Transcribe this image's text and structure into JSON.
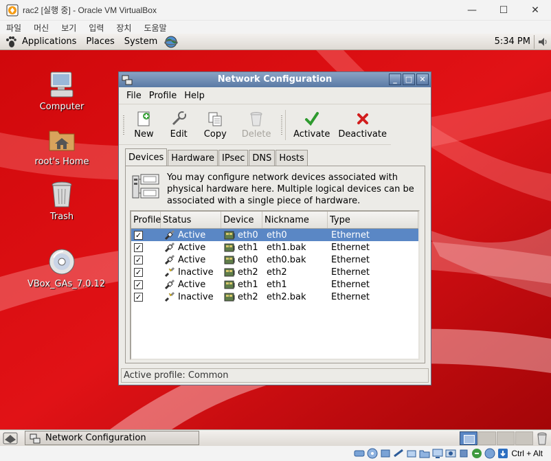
{
  "host": {
    "title": "rac2 [실행 중] - Oracle VM VirtualBox",
    "controls": {
      "minimize": "—",
      "maximize": "☐",
      "close": "✕"
    },
    "menu": [
      "파일",
      "머신",
      "보기",
      "입력",
      "장치",
      "도움말"
    ],
    "status_host_key": "Ctrl + Alt",
    "status_icons": [
      "hard-disk-icon",
      "optical-drive-icon",
      "audio-icon",
      "network-icon",
      "usb-icon",
      "shared-folders-icon",
      "display-icon",
      "recording-icon",
      "cpu-icon",
      "mouse-integration-icon",
      "keyboard-icon",
      "down-arrow-icon"
    ]
  },
  "guest": {
    "top_panel": {
      "menus": [
        "Applications",
        "Places",
        "System"
      ],
      "clock": "5:34 PM"
    },
    "desktop_icons": [
      {
        "label": "Computer",
        "icon": "computer-icon"
      },
      {
        "label": "root's Home",
        "icon": "home-folder-icon"
      },
      {
        "label": "Trash",
        "icon": "trash-icon"
      },
      {
        "label": "VBox_GAs_7.0.12",
        "icon": "cdrom-icon"
      }
    ],
    "bottom_panel": {
      "task_label": "Network Configuration"
    }
  },
  "window": {
    "title": "Network Configuration",
    "menu": [
      "File",
      "Profile",
      "Help"
    ],
    "toolbar": [
      {
        "label": "New",
        "icon": "new-icon",
        "enabled": true
      },
      {
        "label": "Edit",
        "icon": "edit-icon",
        "enabled": true
      },
      {
        "label": "Copy",
        "icon": "copy-icon",
        "enabled": true
      },
      {
        "label": "Delete",
        "icon": "delete-icon",
        "enabled": false
      },
      {
        "label": "Activate",
        "icon": "activate-icon",
        "enabled": true
      },
      {
        "label": "Deactivate",
        "icon": "deactivate-icon",
        "enabled": true
      }
    ],
    "tabs": [
      "Devices",
      "Hardware",
      "IPsec",
      "DNS",
      "Hosts"
    ],
    "active_tab": "Devices",
    "info_text": "You may configure network devices associated with physical hardware here.  Multiple logical devices can be associated with a single piece of hardware.",
    "columns": [
      "Profile",
      "Status",
      "Device",
      "Nickname",
      "Type"
    ],
    "rows": [
      {
        "checked": true,
        "status": "Active",
        "device": "eth0",
        "nickname": "eth0",
        "type": "Ethernet",
        "selected": true
      },
      {
        "checked": true,
        "status": "Active",
        "device": "eth1",
        "nickname": "eth1.bak",
        "type": "Ethernet",
        "selected": false
      },
      {
        "checked": true,
        "status": "Active",
        "device": "eth0",
        "nickname": "eth0.bak",
        "type": "Ethernet",
        "selected": false
      },
      {
        "checked": true,
        "status": "Inactive",
        "device": "eth2",
        "nickname": "eth2",
        "type": "Ethernet",
        "selected": false
      },
      {
        "checked": true,
        "status": "Active",
        "device": "eth1",
        "nickname": "eth1",
        "type": "Ethernet",
        "selected": false
      },
      {
        "checked": true,
        "status": "Inactive",
        "device": "eth2",
        "nickname": "eth2.bak",
        "type": "Ethernet",
        "selected": false
      }
    ],
    "statusbar": "Active profile: Common"
  },
  "colors": {
    "desktop_red": "#c4090d",
    "title_blue": "#5a7aa5",
    "selection_blue": "#5a87c5"
  }
}
